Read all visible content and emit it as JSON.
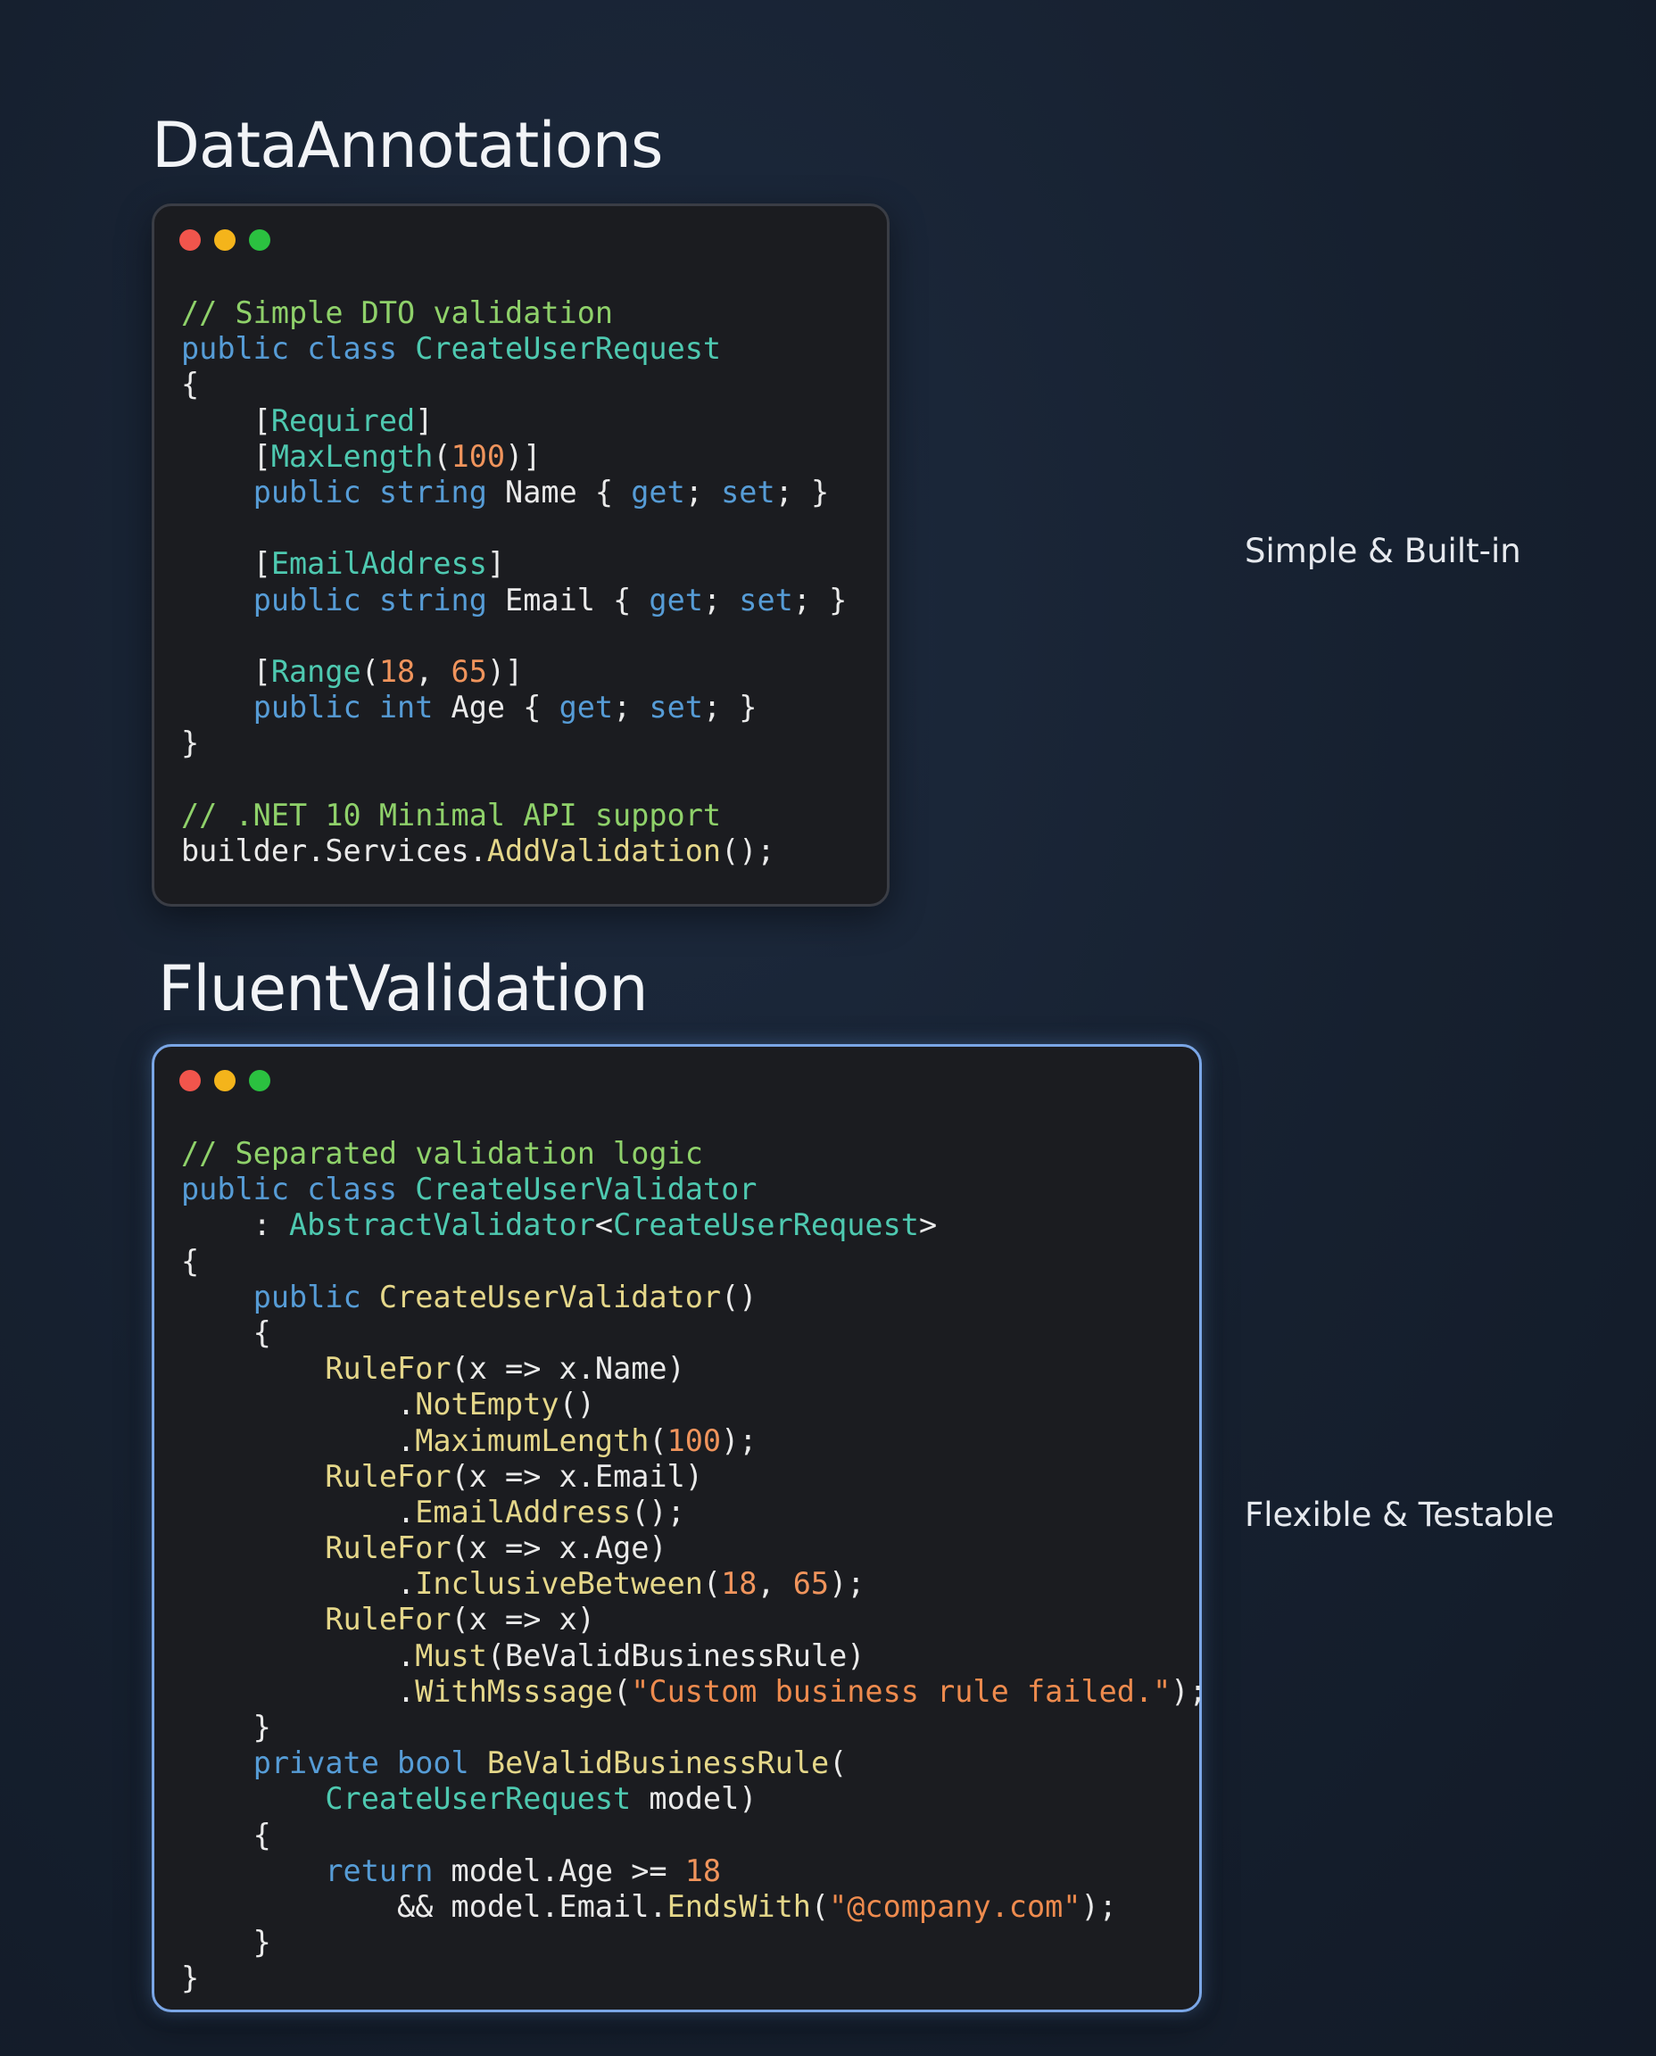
{
  "sections": [
    {
      "title": "DataAnnotations",
      "side_label": "Simple & Built-in",
      "highlighted": false,
      "code_lines": [
        [
          {
            "c": "comment",
            "t": "// Simple DTO validation"
          }
        ],
        [
          {
            "c": "kw",
            "t": "public"
          },
          {
            "c": "plain",
            "t": " "
          },
          {
            "c": "kw",
            "t": "class"
          },
          {
            "c": "plain",
            "t": " "
          },
          {
            "c": "type",
            "t": "CreateUserRequest"
          }
        ],
        [
          {
            "c": "plain",
            "t": "{"
          }
        ],
        [
          {
            "c": "plain",
            "t": "    ["
          },
          {
            "c": "type",
            "t": "Required"
          },
          {
            "c": "plain",
            "t": "]"
          }
        ],
        [
          {
            "c": "plain",
            "t": "    ["
          },
          {
            "c": "type",
            "t": "MaxLength"
          },
          {
            "c": "plain",
            "t": "("
          },
          {
            "c": "num",
            "t": "100"
          },
          {
            "c": "plain",
            "t": ")]"
          }
        ],
        [
          {
            "c": "plain",
            "t": "    "
          },
          {
            "c": "kw",
            "t": "public"
          },
          {
            "c": "plain",
            "t": " "
          },
          {
            "c": "kw",
            "t": "string"
          },
          {
            "c": "plain",
            "t": " Name { "
          },
          {
            "c": "kw",
            "t": "get"
          },
          {
            "c": "plain",
            "t": "; "
          },
          {
            "c": "kw",
            "t": "set"
          },
          {
            "c": "plain",
            "t": "; }"
          }
        ],
        [
          {
            "c": "plain",
            "t": ""
          }
        ],
        [
          {
            "c": "plain",
            "t": "    ["
          },
          {
            "c": "type",
            "t": "EmailAddress"
          },
          {
            "c": "plain",
            "t": "]"
          }
        ],
        [
          {
            "c": "plain",
            "t": "    "
          },
          {
            "c": "kw",
            "t": "public"
          },
          {
            "c": "plain",
            "t": " "
          },
          {
            "c": "kw",
            "t": "string"
          },
          {
            "c": "plain",
            "t": " Email { "
          },
          {
            "c": "kw",
            "t": "get"
          },
          {
            "c": "plain",
            "t": "; "
          },
          {
            "c": "kw",
            "t": "set"
          },
          {
            "c": "plain",
            "t": "; }"
          }
        ],
        [
          {
            "c": "plain",
            "t": ""
          }
        ],
        [
          {
            "c": "plain",
            "t": "    ["
          },
          {
            "c": "type",
            "t": "Range"
          },
          {
            "c": "plain",
            "t": "("
          },
          {
            "c": "num",
            "t": "18"
          },
          {
            "c": "plain",
            "t": ", "
          },
          {
            "c": "num",
            "t": "65"
          },
          {
            "c": "plain",
            "t": ")]"
          }
        ],
        [
          {
            "c": "plain",
            "t": "    "
          },
          {
            "c": "kw",
            "t": "public"
          },
          {
            "c": "plain",
            "t": " "
          },
          {
            "c": "kw",
            "t": "int"
          },
          {
            "c": "plain",
            "t": " Age { "
          },
          {
            "c": "kw",
            "t": "get"
          },
          {
            "c": "plain",
            "t": "; "
          },
          {
            "c": "kw",
            "t": "set"
          },
          {
            "c": "plain",
            "t": "; }"
          }
        ],
        [
          {
            "c": "plain",
            "t": "}"
          }
        ],
        [
          {
            "c": "plain",
            "t": ""
          }
        ],
        [
          {
            "c": "comment",
            "t": "// .NET 10 Minimal API support"
          }
        ],
        [
          {
            "c": "plain",
            "t": "builder.Services."
          },
          {
            "c": "method",
            "t": "AddValidation"
          },
          {
            "c": "plain",
            "t": "();"
          }
        ]
      ]
    },
    {
      "title": "FluentValidation",
      "side_label": "Flexible & Testable",
      "highlighted": true,
      "code_lines": [
        [
          {
            "c": "comment",
            "t": "// Separated validation logic"
          }
        ],
        [
          {
            "c": "kw",
            "t": "public"
          },
          {
            "c": "plain",
            "t": " "
          },
          {
            "c": "kw",
            "t": "class"
          },
          {
            "c": "plain",
            "t": " "
          },
          {
            "c": "type",
            "t": "CreateUserValidator"
          }
        ],
        [
          {
            "c": "plain",
            "t": "    : "
          },
          {
            "c": "type",
            "t": "AbstractValidator"
          },
          {
            "c": "plain",
            "t": "<"
          },
          {
            "c": "type",
            "t": "CreateUserRequest"
          },
          {
            "c": "plain",
            "t": ">"
          }
        ],
        [
          {
            "c": "plain",
            "t": "{"
          }
        ],
        [
          {
            "c": "plain",
            "t": "    "
          },
          {
            "c": "kw",
            "t": "public"
          },
          {
            "c": "plain",
            "t": " "
          },
          {
            "c": "method",
            "t": "CreateUserValidator"
          },
          {
            "c": "plain",
            "t": "()"
          }
        ],
        [
          {
            "c": "plain",
            "t": "    {"
          }
        ],
        [
          {
            "c": "plain",
            "t": "        "
          },
          {
            "c": "method",
            "t": "RuleFor"
          },
          {
            "c": "plain",
            "t": "(x => x.Name)"
          }
        ],
        [
          {
            "c": "plain",
            "t": "            ."
          },
          {
            "c": "method",
            "t": "NotEmpty"
          },
          {
            "c": "plain",
            "t": "()"
          }
        ],
        [
          {
            "c": "plain",
            "t": "            ."
          },
          {
            "c": "method",
            "t": "MaximumLength"
          },
          {
            "c": "plain",
            "t": "("
          },
          {
            "c": "num",
            "t": "100"
          },
          {
            "c": "plain",
            "t": ");"
          }
        ],
        [
          {
            "c": "plain",
            "t": "        "
          },
          {
            "c": "method",
            "t": "RuleFor"
          },
          {
            "c": "plain",
            "t": "(x => x.Email)"
          }
        ],
        [
          {
            "c": "plain",
            "t": "            ."
          },
          {
            "c": "method",
            "t": "EmailAddress"
          },
          {
            "c": "plain",
            "t": "();"
          }
        ],
        [
          {
            "c": "plain",
            "t": "        "
          },
          {
            "c": "method",
            "t": "RuleFor"
          },
          {
            "c": "plain",
            "t": "(x => x.Age)"
          }
        ],
        [
          {
            "c": "plain",
            "t": "            ."
          },
          {
            "c": "method",
            "t": "InclusiveBetween"
          },
          {
            "c": "plain",
            "t": "("
          },
          {
            "c": "num",
            "t": "18"
          },
          {
            "c": "plain",
            "t": ", "
          },
          {
            "c": "num",
            "t": "65"
          },
          {
            "c": "plain",
            "t": ");"
          }
        ],
        [
          {
            "c": "plain",
            "t": "        "
          },
          {
            "c": "method",
            "t": "RuleFor"
          },
          {
            "c": "plain",
            "t": "(x => x)"
          }
        ],
        [
          {
            "c": "plain",
            "t": "            ."
          },
          {
            "c": "method",
            "t": "Must"
          },
          {
            "c": "plain",
            "t": "(BeValidBusinessRule)"
          }
        ],
        [
          {
            "c": "plain",
            "t": "            ."
          },
          {
            "c": "method",
            "t": "WithMsssage"
          },
          {
            "c": "plain",
            "t": "("
          },
          {
            "c": "str",
            "t": "\"Custom business rule failed.\""
          },
          {
            "c": "plain",
            "t": ");"
          }
        ],
        [
          {
            "c": "plain",
            "t": "    }"
          }
        ],
        [
          {
            "c": "plain",
            "t": "    "
          },
          {
            "c": "kw",
            "t": "private"
          },
          {
            "c": "plain",
            "t": " "
          },
          {
            "c": "kw",
            "t": "bool"
          },
          {
            "c": "plain",
            "t": " "
          },
          {
            "c": "method",
            "t": "BeValidBusinessRule"
          },
          {
            "c": "plain",
            "t": "("
          }
        ],
        [
          {
            "c": "plain",
            "t": "        "
          },
          {
            "c": "type",
            "t": "CreateUserRequest"
          },
          {
            "c": "plain",
            "t": " model)"
          }
        ],
        [
          {
            "c": "plain",
            "t": "    {"
          }
        ],
        [
          {
            "c": "plain",
            "t": "        "
          },
          {
            "c": "kw",
            "t": "return"
          },
          {
            "c": "plain",
            "t": " model.Age >= "
          },
          {
            "c": "num",
            "t": "18"
          }
        ],
        [
          {
            "c": "plain",
            "t": "            && model.Email."
          },
          {
            "c": "method",
            "t": "EndsWith"
          },
          {
            "c": "plain",
            "t": "("
          },
          {
            "c": "str",
            "t": "\"@company.com\""
          },
          {
            "c": "plain",
            "t": ");"
          }
        ],
        [
          {
            "c": "plain",
            "t": "    }"
          }
        ],
        [
          {
            "c": "plain",
            "t": "}"
          }
        ]
      ]
    }
  ],
  "window_controls": {
    "red": "#f1554c",
    "yellow": "#f4b41b",
    "green": "#2bc140",
    "icons": [
      "close-dot-icon",
      "minimize-dot-icon",
      "maximize-dot-icon"
    ]
  },
  "colors": {
    "background": "#16202f",
    "code_background": "#1b1c20",
    "highlight_border": "#7aa6e6",
    "comment": "#8fd16a",
    "keyword": "#569cd6",
    "type": "#4ec9b0",
    "method": "#e5d78a",
    "number": "#f0945c",
    "string": "#ee8b4e"
  }
}
